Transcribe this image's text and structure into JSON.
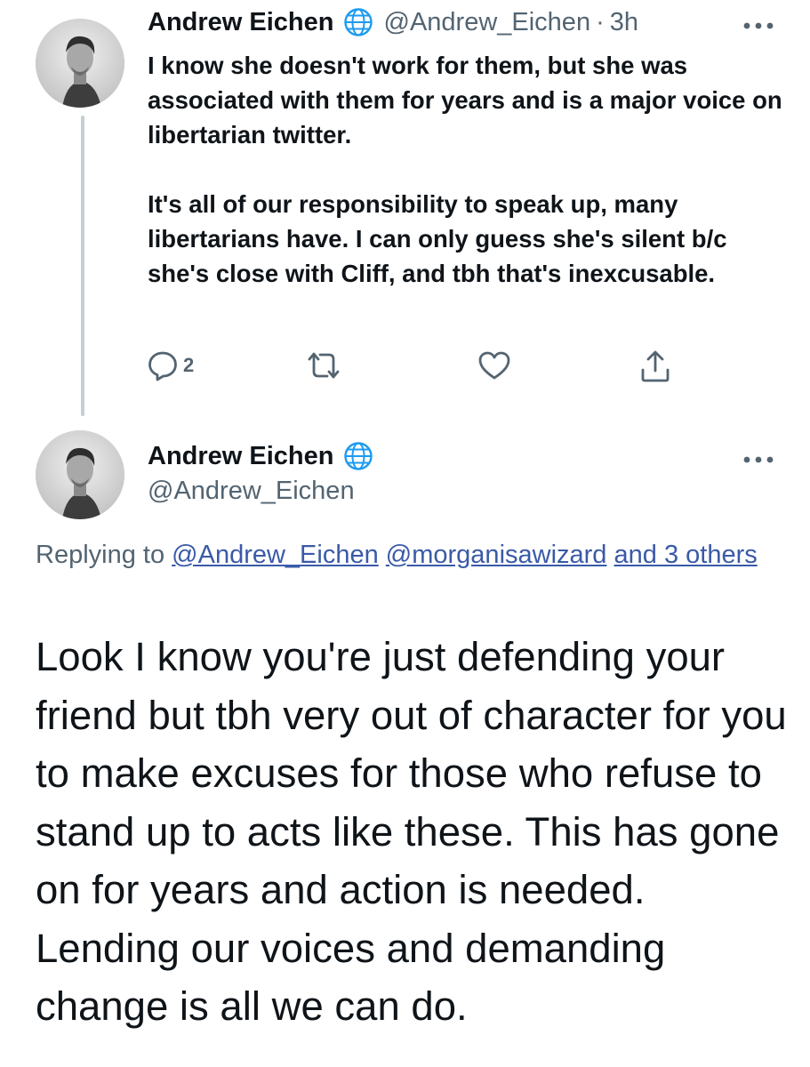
{
  "tweet1": {
    "author_name": "Andrew Eichen",
    "handle": "@Andrew_Eichen",
    "separator": "·",
    "time": "3h",
    "paragraphs": [
      "I know she doesn't work for them, but she was associated with them for years and is a major voice on libertarian twitter.",
      "It's all of our responsibility to speak up, many libertarians have. I can only guess she's silent b/c she's close with Cliff, and tbh that's inexcusable."
    ],
    "reply_count": "2",
    "icons": [
      "reply-icon",
      "retweet-icon",
      "like-icon",
      "share-icon",
      "more-icon",
      "globe-icon"
    ]
  },
  "tweet2": {
    "author_name": "Andrew Eichen",
    "handle": "@Andrew_Eichen",
    "replying_prefix": "Replying to ",
    "replying_links": [
      "@Andrew_Eichen",
      "@morganisawizard",
      "and 3 others"
    ],
    "text": "Look I know you're just defending your friend but tbh very out of character for you to make excuses for those who refuse to stand up to acts like these. This has gone on for years and action is needed. Lending our voices and demanding change is all we can do."
  },
  "colors": {
    "text": "#0f1419",
    "secondary": "#536471",
    "link": "#3a5aa8",
    "thread_line": "#c4cfd6",
    "globe": "#1d9bf0"
  }
}
